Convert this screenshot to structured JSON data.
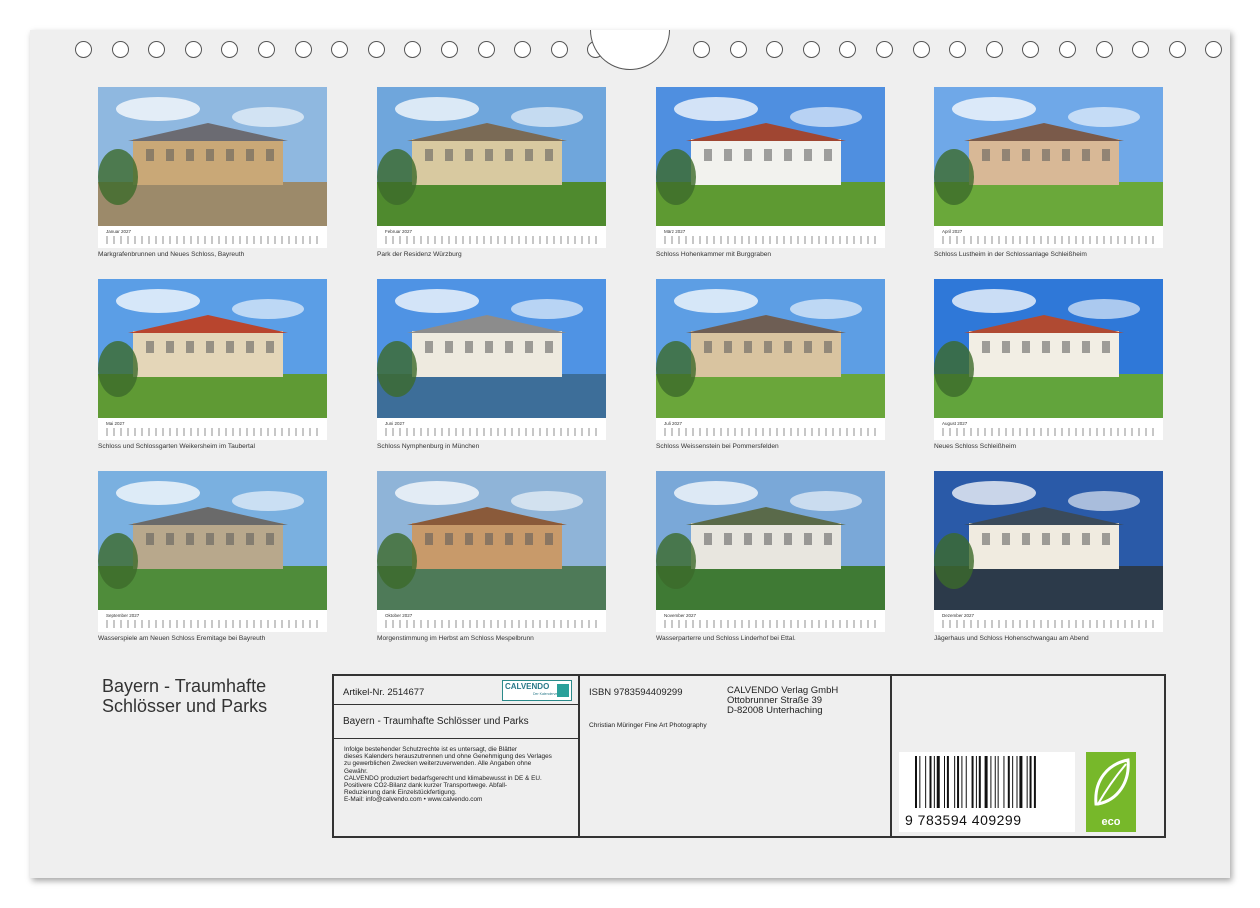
{
  "months": [
    {
      "name": "Januar 2027",
      "caption": "Markgrafenbrunnen und Neues Schloss, Bayreuth"
    },
    {
      "name": "Februar 2027",
      "caption": "Park der Residenz Würzburg"
    },
    {
      "name": "März 2027",
      "caption": "Schloss Hohenkammer mit Burggraben"
    },
    {
      "name": "April 2027",
      "caption": "Schloss Lustheim in der Schlossanlage Schleißheim"
    },
    {
      "name": "Mai 2027",
      "caption": "Schloss und Schlossgarten Weikersheim im Taubertal"
    },
    {
      "name": "Juni 2027",
      "caption": "Schloss Nymphenburg in München"
    },
    {
      "name": "Juli 2027",
      "caption": "Schloss Weissenstein bei Pommersfelden"
    },
    {
      "name": "August 2027",
      "caption": "Neues Schloss Schleißheim"
    },
    {
      "name": "September 2027",
      "caption": "Wasserspiele am Neuen Schloss Eremitage bei Bayreuth"
    },
    {
      "name": "Oktober 2027",
      "caption": "Morgenstimmung im Herbst am Schloss Mespelbrunn"
    },
    {
      "name": "November 2027",
      "caption": "Wasserparterre und Schloss Linderhof bei Ettal."
    },
    {
      "name": "Dezember 2027",
      "caption": "Jägerhaus und Schloss Hohenschwangau am Abend"
    }
  ],
  "cover_title": {
    "line1": "Bayern - Traumhafte",
    "line2": "Schlösser und Parks"
  },
  "info": {
    "article": "Artikel-Nr. 2514677",
    "logo_text": "CALVENDO",
    "logo_sub": "Der Kalenderverlag",
    "product_title": "Bayern - Traumhafte Schlösser und Parks",
    "legal": [
      "Infolge bestehender Schutzrechte ist es untersagt, die Blätter",
      "dieses Kalenders herauszutrennen und ohne Genehmigung des Verlages",
      "zu gewerblichen Zwecken weiterzuverwenden. Alle Angaben ohne",
      "Gewähr.",
      "CALVENDO produziert bedarfsgerecht und klimabewusst in DE & EU.",
      "Positivere CO2-Bilanz dank kurzer Transportwege. Abfall-",
      "Reduzierung dank Einzelstückfertigung.",
      "E-Mail: info@calvendo.com • www.calvendo.com"
    ],
    "isbn": "ISBN 9783594409299",
    "publisher": [
      "CALVENDO Verlag GmbH",
      "Ottobrunner Straße 39",
      "D-82008 Unterhaching"
    ],
    "photographer": "Christian Müringer Fine Art Photography",
    "barcode_number": "9  783594  409299",
    "eco_label": "eco"
  },
  "colors": {
    "sheet": "#efefef",
    "eco_green": "#77b82a",
    "calvendo_teal": "#2a8a8a"
  }
}
